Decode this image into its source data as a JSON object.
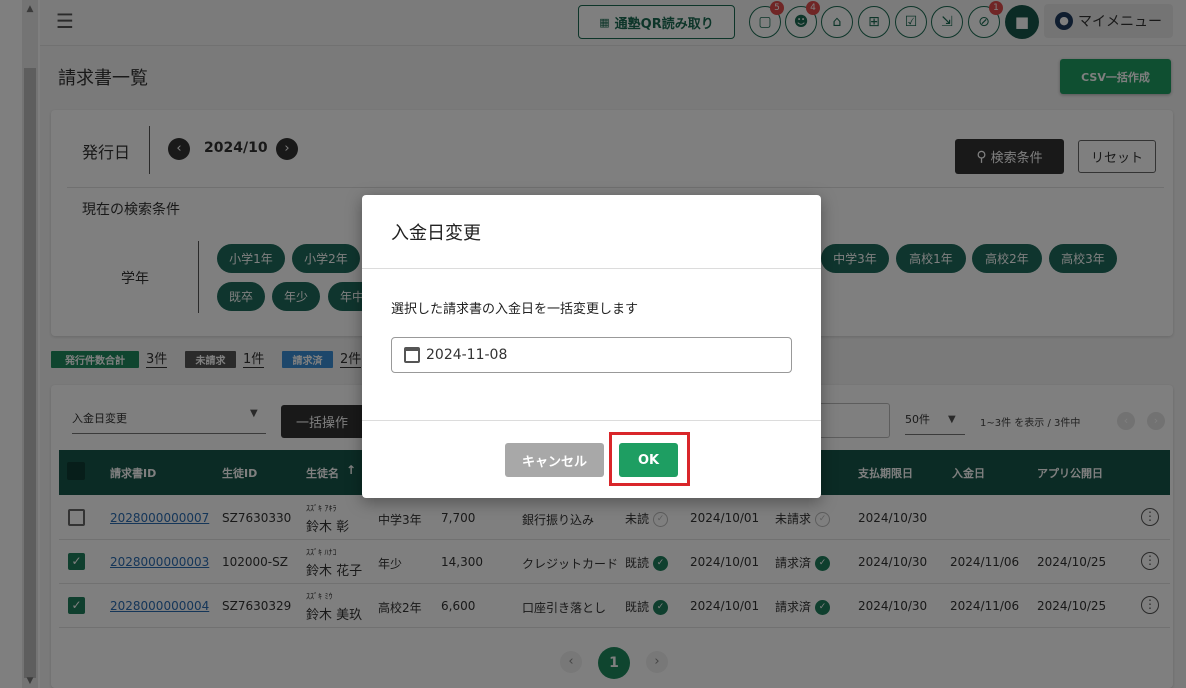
{
  "topbar": {
    "qr_button_label": "通塾QR読み取り",
    "badges": {
      "messages": "5",
      "students": "4",
      "alerts": "1"
    },
    "my_menu_label": "マイメニュー"
  },
  "page": {
    "title": "請求書一覧",
    "csv_button_label": "CSV一括作成"
  },
  "filter": {
    "issue_date_label": "発行日",
    "month_value": "2024/10",
    "search_button_label": "検索条件",
    "reset_button_label": "リセット",
    "current_conditions_label": "現在の検索条件",
    "grade_label": "学年",
    "grade_chips_row1": [
      "小学1年",
      "小学2年",
      "中学3年",
      "高校1年",
      "高校2年",
      "高校3年"
    ],
    "grade_chips_row2": [
      "既卒",
      "年少",
      "年中"
    ]
  },
  "counts": {
    "issued_label": "発行件数合計",
    "issued_value": "3件",
    "unbilled_label": "未請求",
    "unbilled_value": "1件",
    "billed_label": "請求済",
    "billed_value": "2件"
  },
  "table": {
    "bulk_select_value": "入金日変更",
    "bulk_ops_label": "一括操作",
    "per_page_value": "50件",
    "range_text": "1~3件 を表示 / 3件中",
    "headers": {
      "id": "請求書ID",
      "student_id": "生徒ID",
      "student_name": "生徒名",
      "due_date": "支払期限日",
      "payment_date": "入金日",
      "app_date": "アプリ公開日"
    },
    "rows": [
      {
        "id": "2028000000007",
        "student_id": "SZ7630330",
        "kana": "ｽｽﾞｷ ｱｷﾗ",
        "name": "鈴木 彰",
        "grade": "中学3年",
        "amount": "7,700",
        "method": "銀行振り込み",
        "read": "未読",
        "issue": "2024/10/01",
        "status": "未請求",
        "due": "2024/10/30",
        "paid": "",
        "published": ""
      },
      {
        "id": "2028000000003",
        "student_id": "102000-SZ",
        "kana": "ｽｽﾞｷ ﾊﾅｺ",
        "name": "鈴木 花子",
        "grade": "年少",
        "amount": "14,300",
        "method": "クレジットカード",
        "read": "既読",
        "issue": "2024/10/01",
        "status": "請求済",
        "due": "2024/10/30",
        "paid": "2024/11/06",
        "published": "2024/10/25"
      },
      {
        "id": "2028000000004",
        "student_id": "SZ7630329",
        "kana": "ｽｽﾞｷ ﾐｳ",
        "name": "鈴木 美玖",
        "grade": "高校2年",
        "amount": "6,600",
        "method": "口座引き落とし",
        "read": "既読",
        "issue": "2024/10/01",
        "status": "請求済",
        "due": "2024/10/30",
        "paid": "2024/11/06",
        "published": "2024/10/25"
      }
    ],
    "current_page": "1"
  },
  "dialog": {
    "title": "入金日変更",
    "message": "選択した請求書の入金日を一括変更します",
    "date_value": "2024-11-08",
    "cancel_label": "キャンセル",
    "ok_label": "OK"
  },
  "colors": {
    "primary": "#1e6b5c",
    "accent": "#1e9e62",
    "highlight": "#d9262a"
  }
}
